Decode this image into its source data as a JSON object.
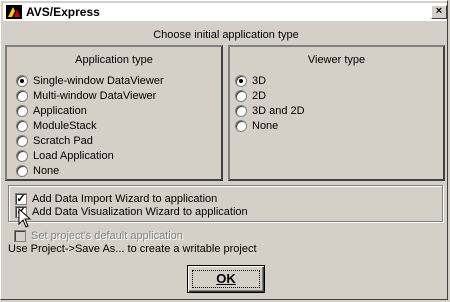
{
  "window": {
    "title": "AVS/Express",
    "close_glyph": "×"
  },
  "heading": "Choose initial application type",
  "application_type": {
    "title": "Application type",
    "options": [
      {
        "label": "Single-window DataViewer",
        "checked": true
      },
      {
        "label": "Multi-window DataViewer",
        "checked": false
      },
      {
        "label": "Application",
        "checked": false
      },
      {
        "label": "ModuleStack",
        "checked": false
      },
      {
        "label": "Scratch Pad",
        "checked": false
      },
      {
        "label": "Load Application",
        "checked": false
      },
      {
        "label": "None",
        "checked": false
      }
    ]
  },
  "viewer_type": {
    "title": "Viewer type",
    "options": [
      {
        "label": "3D",
        "checked": true
      },
      {
        "label": "2D",
        "checked": false
      },
      {
        "label": "3D and 2D",
        "checked": false
      },
      {
        "label": "None",
        "checked": false
      }
    ]
  },
  "wizards": {
    "import_label": "Add Data Import Wizard to application",
    "import_checked": true,
    "visualization_label": "Add Data Visualization Wizard to application",
    "visualization_checked": true
  },
  "project": {
    "default_label": "Set project's default application",
    "default_enabled": false,
    "hint": "Use Project->Save As... to create a writable project"
  },
  "ok_label": "OK",
  "icons": {
    "title": "avs-logo-icon",
    "cursor": "mouse-pointer-icon"
  }
}
